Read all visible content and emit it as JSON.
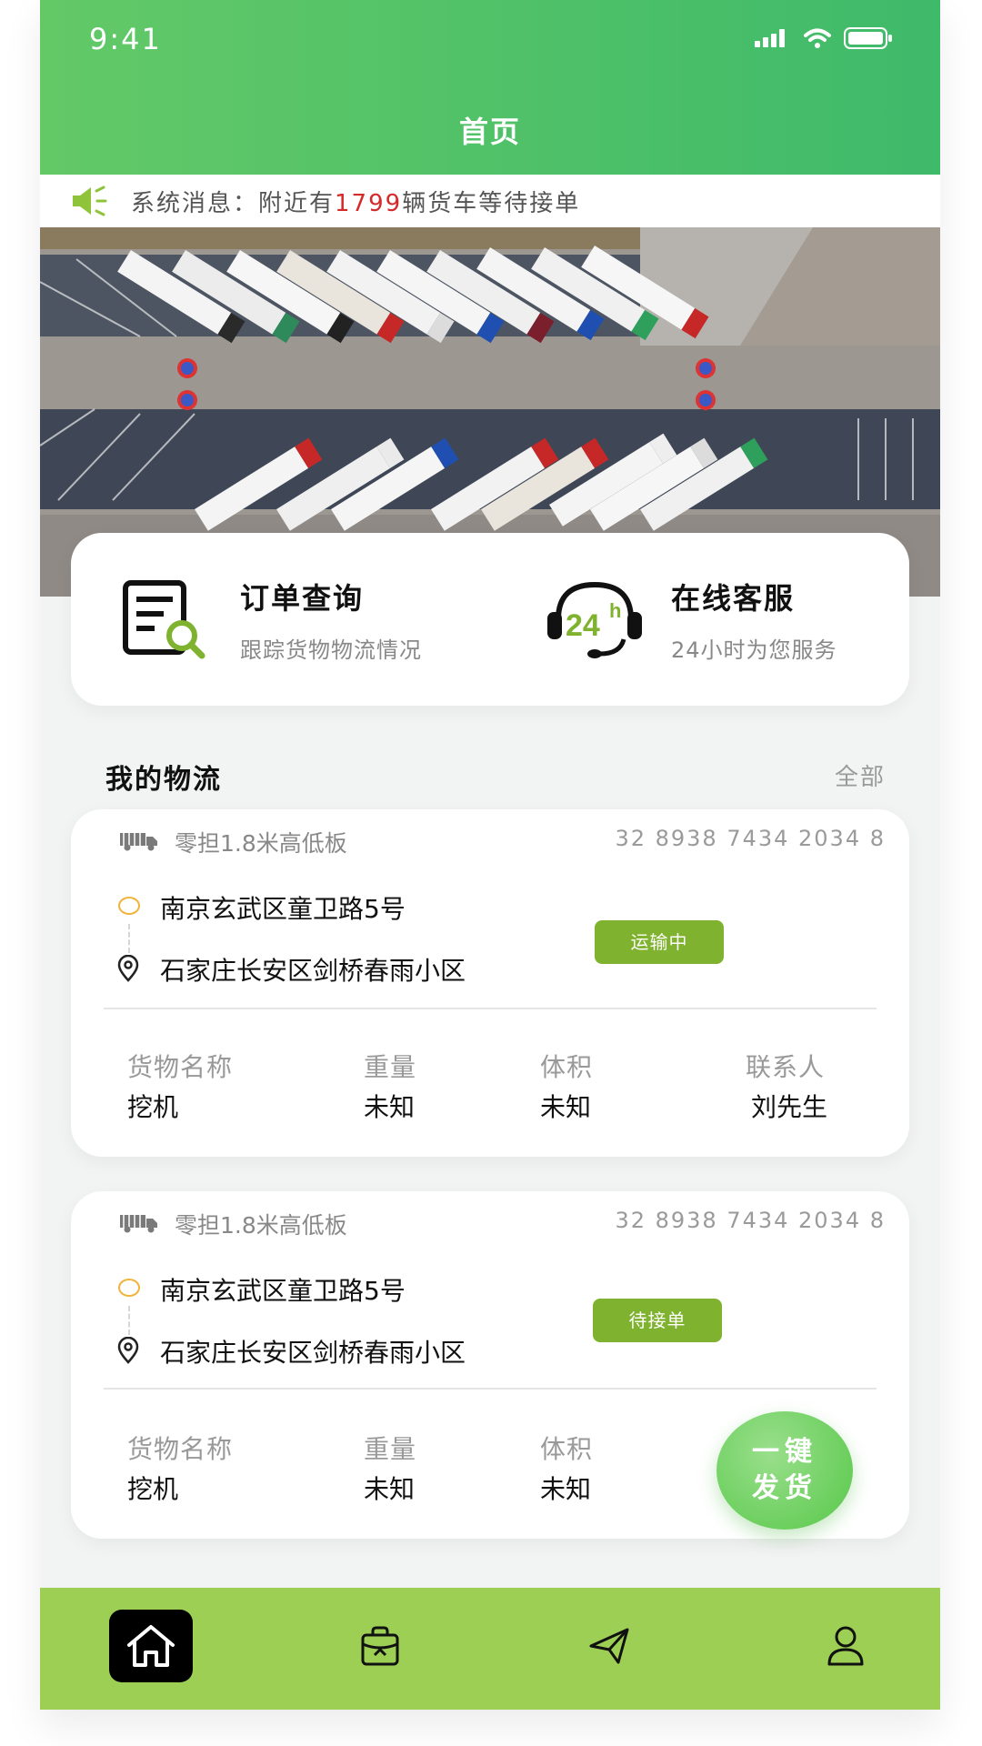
{
  "status_bar": {
    "time": "9:41"
  },
  "header": {
    "title": "首页"
  },
  "notice": {
    "prefix": "系统消息：附近有",
    "count": "1799",
    "suffix": "辆货车等待接单"
  },
  "quick_actions": [
    {
      "title": "订单查询",
      "subtitle": "跟踪货物物流情况",
      "icon": "order-search-icon"
    },
    {
      "title": "在线客服",
      "subtitle": "24小时为您服务",
      "icon": "24h-support-icon"
    }
  ],
  "section": {
    "title": "我的物流",
    "all_label": "全部"
  },
  "shipments": [
    {
      "type": "零担1.8米高低板",
      "code": "32 8938 7434 2034 8",
      "from": "南京玄武区童卫路5号",
      "to": "石家庄长安区剑桥春雨小区",
      "status": "运输中",
      "fields": [
        {
          "label": "货物名称",
          "value": "挖机"
        },
        {
          "label": "重量",
          "value": "未知"
        },
        {
          "label": "体积",
          "value": "未知"
        },
        {
          "label": "联系人",
          "value": "刘先生"
        }
      ]
    },
    {
      "type": "零担1.8米高低板",
      "code": "32 8938 7434 2034 8",
      "from": "南京玄武区童卫路5号",
      "to": "石家庄长安区剑桥春雨小区",
      "status": "待接单",
      "fields": [
        {
          "label": "货物名称",
          "value": "挖机"
        },
        {
          "label": "重量",
          "value": "未知"
        },
        {
          "label": "体积",
          "value": "未知"
        }
      ]
    }
  ],
  "fab": {
    "line1": "一键",
    "line2": "发货"
  },
  "tabbar": {
    "items": [
      "home-icon",
      "bag-icon",
      "send-icon",
      "user-icon"
    ],
    "active": "home-icon"
  },
  "colors": {
    "header_green": "#4fc06a",
    "accent_green": "#7fb22e",
    "tabbar_green": "#9ccf53",
    "highlight_red": "#d42a2a"
  }
}
